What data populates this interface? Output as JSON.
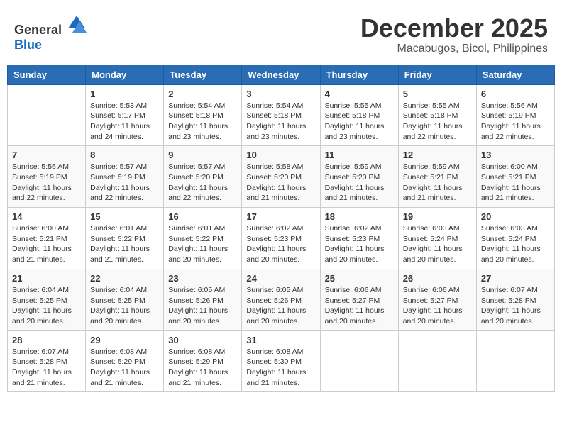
{
  "logo": {
    "general": "General",
    "blue": "Blue"
  },
  "header": {
    "month_year": "December 2025",
    "location": "Macabugos, Bicol, Philippines"
  },
  "weekdays": [
    "Sunday",
    "Monday",
    "Tuesday",
    "Wednesday",
    "Thursday",
    "Friday",
    "Saturday"
  ],
  "weeks": [
    [
      {
        "day": "",
        "info": ""
      },
      {
        "day": "1",
        "info": "Sunrise: 5:53 AM\nSunset: 5:17 PM\nDaylight: 11 hours\nand 24 minutes."
      },
      {
        "day": "2",
        "info": "Sunrise: 5:54 AM\nSunset: 5:18 PM\nDaylight: 11 hours\nand 23 minutes."
      },
      {
        "day": "3",
        "info": "Sunrise: 5:54 AM\nSunset: 5:18 PM\nDaylight: 11 hours\nand 23 minutes."
      },
      {
        "day": "4",
        "info": "Sunrise: 5:55 AM\nSunset: 5:18 PM\nDaylight: 11 hours\nand 23 minutes."
      },
      {
        "day": "5",
        "info": "Sunrise: 5:55 AM\nSunset: 5:18 PM\nDaylight: 11 hours\nand 22 minutes."
      },
      {
        "day": "6",
        "info": "Sunrise: 5:56 AM\nSunset: 5:19 PM\nDaylight: 11 hours\nand 22 minutes."
      }
    ],
    [
      {
        "day": "7",
        "info": "Sunrise: 5:56 AM\nSunset: 5:19 PM\nDaylight: 11 hours\nand 22 minutes."
      },
      {
        "day": "8",
        "info": "Sunrise: 5:57 AM\nSunset: 5:19 PM\nDaylight: 11 hours\nand 22 minutes."
      },
      {
        "day": "9",
        "info": "Sunrise: 5:57 AM\nSunset: 5:20 PM\nDaylight: 11 hours\nand 22 minutes."
      },
      {
        "day": "10",
        "info": "Sunrise: 5:58 AM\nSunset: 5:20 PM\nDaylight: 11 hours\nand 21 minutes."
      },
      {
        "day": "11",
        "info": "Sunrise: 5:59 AM\nSunset: 5:20 PM\nDaylight: 11 hours\nand 21 minutes."
      },
      {
        "day": "12",
        "info": "Sunrise: 5:59 AM\nSunset: 5:21 PM\nDaylight: 11 hours\nand 21 minutes."
      },
      {
        "day": "13",
        "info": "Sunrise: 6:00 AM\nSunset: 5:21 PM\nDaylight: 11 hours\nand 21 minutes."
      }
    ],
    [
      {
        "day": "14",
        "info": "Sunrise: 6:00 AM\nSunset: 5:21 PM\nDaylight: 11 hours\nand 21 minutes."
      },
      {
        "day": "15",
        "info": "Sunrise: 6:01 AM\nSunset: 5:22 PM\nDaylight: 11 hours\nand 21 minutes."
      },
      {
        "day": "16",
        "info": "Sunrise: 6:01 AM\nSunset: 5:22 PM\nDaylight: 11 hours\nand 20 minutes."
      },
      {
        "day": "17",
        "info": "Sunrise: 6:02 AM\nSunset: 5:23 PM\nDaylight: 11 hours\nand 20 minutes."
      },
      {
        "day": "18",
        "info": "Sunrise: 6:02 AM\nSunset: 5:23 PM\nDaylight: 11 hours\nand 20 minutes."
      },
      {
        "day": "19",
        "info": "Sunrise: 6:03 AM\nSunset: 5:24 PM\nDaylight: 11 hours\nand 20 minutes."
      },
      {
        "day": "20",
        "info": "Sunrise: 6:03 AM\nSunset: 5:24 PM\nDaylight: 11 hours\nand 20 minutes."
      }
    ],
    [
      {
        "day": "21",
        "info": "Sunrise: 6:04 AM\nSunset: 5:25 PM\nDaylight: 11 hours\nand 20 minutes."
      },
      {
        "day": "22",
        "info": "Sunrise: 6:04 AM\nSunset: 5:25 PM\nDaylight: 11 hours\nand 20 minutes."
      },
      {
        "day": "23",
        "info": "Sunrise: 6:05 AM\nSunset: 5:26 PM\nDaylight: 11 hours\nand 20 minutes."
      },
      {
        "day": "24",
        "info": "Sunrise: 6:05 AM\nSunset: 5:26 PM\nDaylight: 11 hours\nand 20 minutes."
      },
      {
        "day": "25",
        "info": "Sunrise: 6:06 AM\nSunset: 5:27 PM\nDaylight: 11 hours\nand 20 minutes."
      },
      {
        "day": "26",
        "info": "Sunrise: 6:06 AM\nSunset: 5:27 PM\nDaylight: 11 hours\nand 20 minutes."
      },
      {
        "day": "27",
        "info": "Sunrise: 6:07 AM\nSunset: 5:28 PM\nDaylight: 11 hours\nand 20 minutes."
      }
    ],
    [
      {
        "day": "28",
        "info": "Sunrise: 6:07 AM\nSunset: 5:28 PM\nDaylight: 11 hours\nand 21 minutes."
      },
      {
        "day": "29",
        "info": "Sunrise: 6:08 AM\nSunset: 5:29 PM\nDaylight: 11 hours\nand 21 minutes."
      },
      {
        "day": "30",
        "info": "Sunrise: 6:08 AM\nSunset: 5:29 PM\nDaylight: 11 hours\nand 21 minutes."
      },
      {
        "day": "31",
        "info": "Sunrise: 6:08 AM\nSunset: 5:30 PM\nDaylight: 11 hours\nand 21 minutes."
      },
      {
        "day": "",
        "info": ""
      },
      {
        "day": "",
        "info": ""
      },
      {
        "day": "",
        "info": ""
      }
    ]
  ]
}
